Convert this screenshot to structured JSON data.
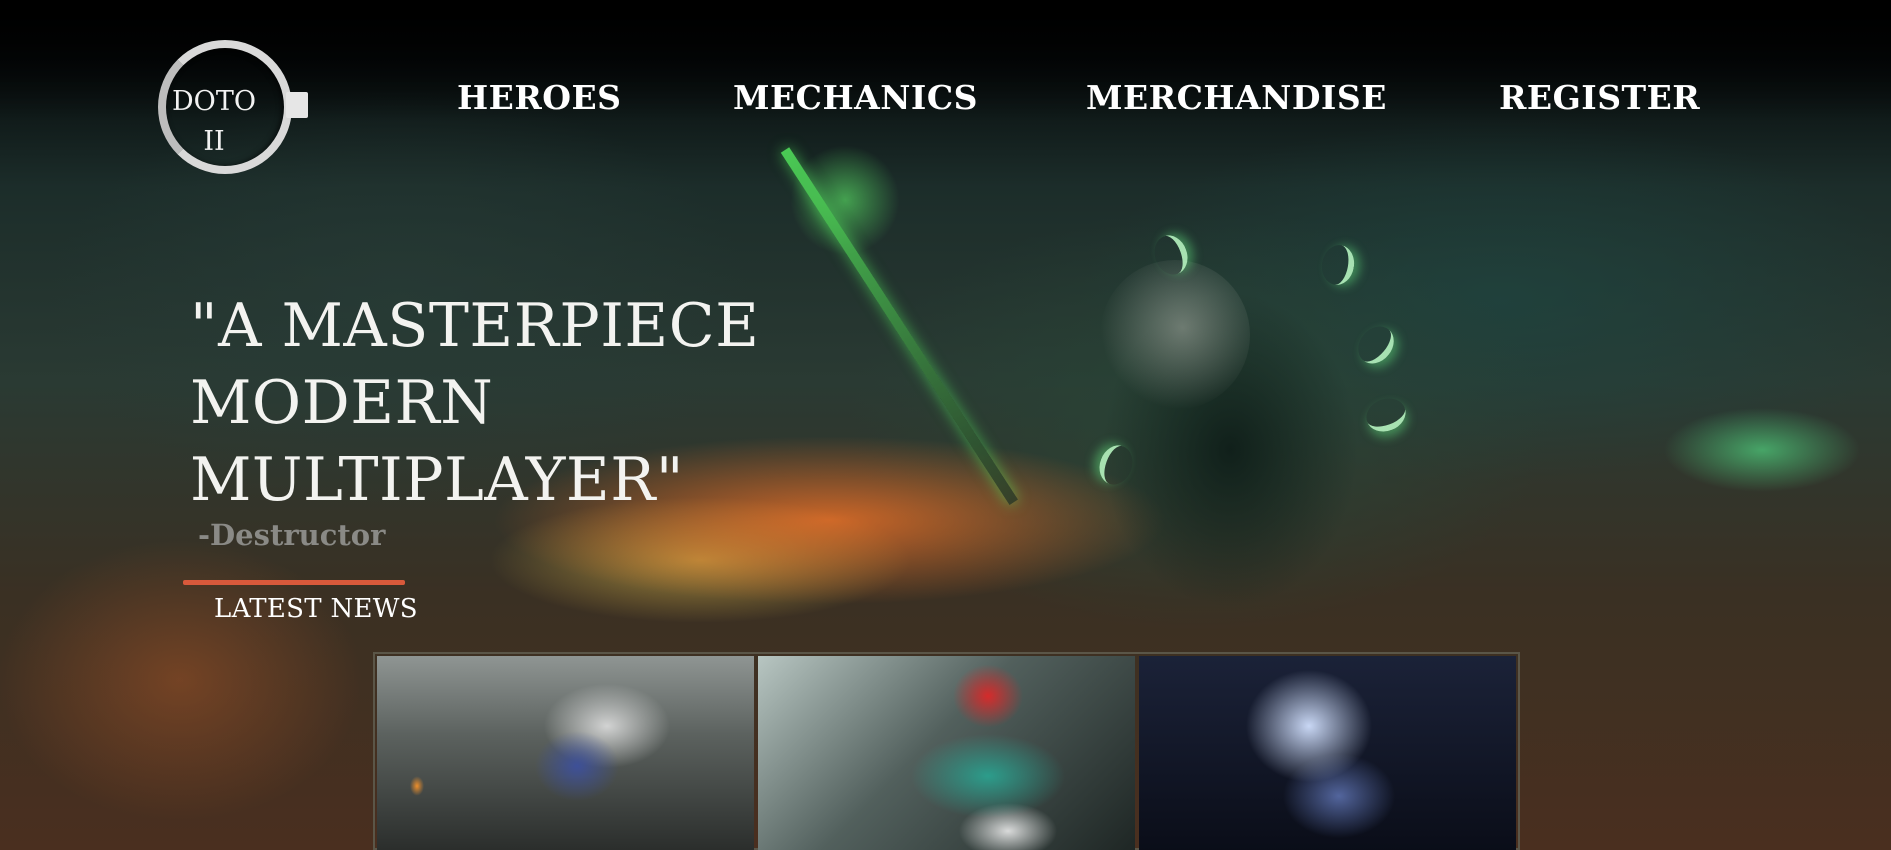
{
  "logo": {
    "line1": "DOTO",
    "line2": "II"
  },
  "nav": {
    "items": [
      {
        "label": "HEROES"
      },
      {
        "label": "MECHANICS"
      },
      {
        "label": "MERCHANDISE"
      },
      {
        "label": "REGISTER"
      }
    ]
  },
  "hero": {
    "quote_lines": [
      "\"A MASTERPIECE",
      "MODERN",
      "MULTIPLAYER\""
    ],
    "attribution": "-Destructor"
  },
  "news": {
    "title": "LATEST NEWS",
    "cards": [
      {
        "image": "dark-forest-creature-artwork"
      },
      {
        "image": "red-haired-windrunner-artwork"
      },
      {
        "image": "drow-ranger-archer-artwork"
      }
    ]
  },
  "colors": {
    "accent_underline": "#d8593b",
    "nav_text": "#ffffff",
    "attribution_text": "#8a8a86"
  }
}
